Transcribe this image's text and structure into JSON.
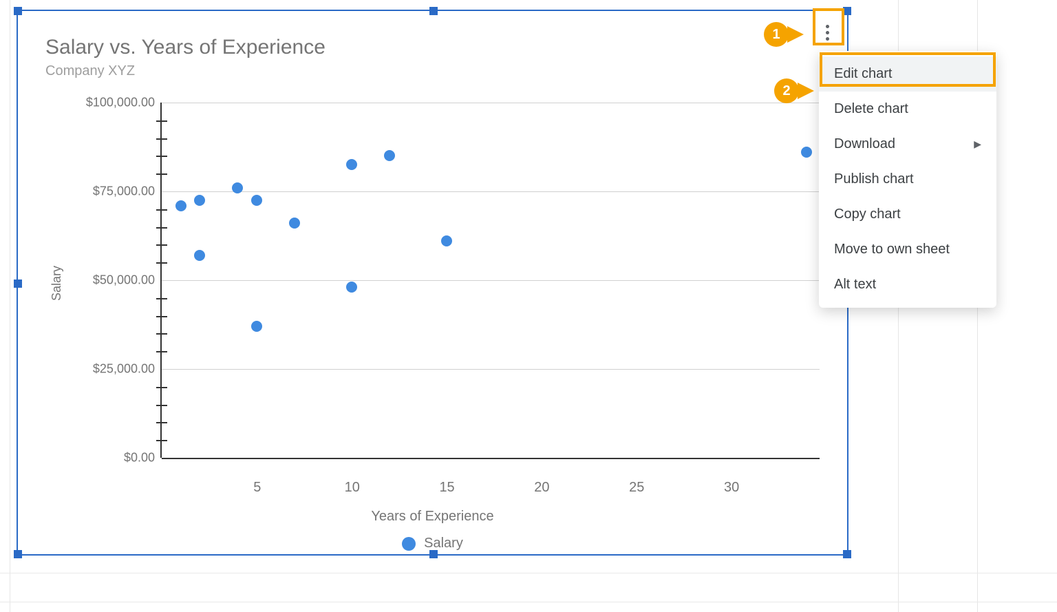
{
  "chart": {
    "title": "Salary vs. Years of Experience",
    "subtitle": "Company XYZ",
    "xlabel": "Years of Experience",
    "ylabel": "Salary",
    "legend_label": "Salary",
    "point_color": "#3f8ae0",
    "y_ticks": [
      "$0.00",
      "$25,000.00",
      "$50,000.00",
      "$75,000.00",
      "$100,000.00"
    ],
    "x_ticks": [
      "5",
      "10",
      "15",
      "20",
      "25",
      "30"
    ]
  },
  "menu": {
    "items": [
      {
        "label": "Edit chart",
        "submenu": false,
        "hovered": true
      },
      {
        "label": "Delete chart",
        "submenu": false,
        "hovered": false
      },
      {
        "label": "Download",
        "submenu": true,
        "hovered": false
      },
      {
        "label": "Publish chart",
        "submenu": false,
        "hovered": false
      },
      {
        "label": "Copy chart",
        "submenu": false,
        "hovered": false
      },
      {
        "label": "Move to own sheet",
        "submenu": false,
        "hovered": false
      },
      {
        "label": "Alt text",
        "submenu": false,
        "hovered": false
      }
    ]
  },
  "callouts": {
    "one": "1",
    "two": "2"
  },
  "chart_data": {
    "type": "scatter",
    "title": "Salary vs. Years of Experience",
    "subtitle": "Company XYZ",
    "xlabel": "Years of Experience",
    "ylabel": "Salary",
    "xlim": [
      0,
      35
    ],
    "ylim": [
      0,
      100000
    ],
    "x_ticks": [
      5,
      10,
      15,
      20,
      25,
      30
    ],
    "y_ticks": [
      0,
      25000,
      50000,
      75000,
      100000
    ],
    "legend": [
      "Salary"
    ],
    "series": [
      {
        "name": "Salary",
        "color": "#3f8ae0",
        "points": [
          {
            "x": 1,
            "y": 71000
          },
          {
            "x": 2,
            "y": 72500
          },
          {
            "x": 2,
            "y": 57000
          },
          {
            "x": 4,
            "y": 76000
          },
          {
            "x": 5,
            "y": 72500
          },
          {
            "x": 5,
            "y": 37000
          },
          {
            "x": 7,
            "y": 66000
          },
          {
            "x": 10,
            "y": 82500
          },
          {
            "x": 10,
            "y": 48000
          },
          {
            "x": 12,
            "y": 85000
          },
          {
            "x": 15,
            "y": 61000
          },
          {
            "x": 34,
            "y": 86000
          }
        ]
      }
    ]
  }
}
